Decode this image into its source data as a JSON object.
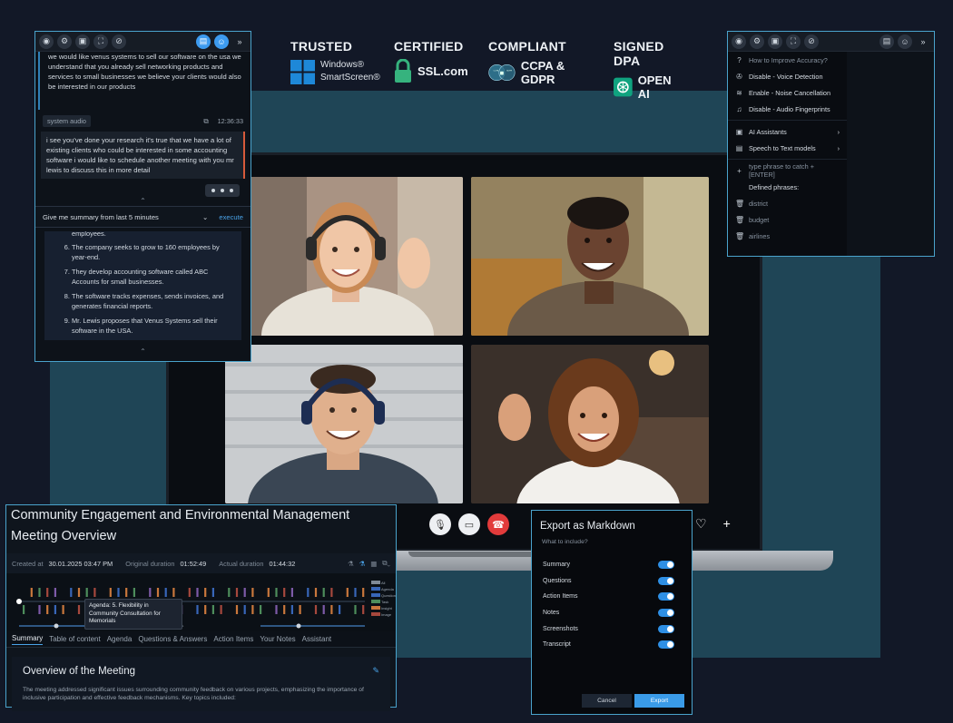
{
  "badges": {
    "trusted": {
      "title": "TRUSTED",
      "line1": "Windows®",
      "line2": "SmartScreen®"
    },
    "certified": {
      "title": "CERTIFIED",
      "name": "SSL.com"
    },
    "compliant": {
      "title": "COMPLIANT",
      "name": "CCPA & GDPR",
      "logo_left": "CCPA",
      "logo_right": "GDPR"
    },
    "dpa": {
      "title": "SIGNED DPA",
      "name": "OPEN AI"
    }
  },
  "left_panel": {
    "transcript_top": "we would like venus systems to sell our software on the usa we understand that you already sell networking products and services to small businesses we believe your clients would also be interested in our products",
    "system_audio_label": "system audio",
    "system_audio_time": "12:36:33",
    "system_audio_text": "i see you've done your research it's true that we have a lot of existing clients who could be interested in some accounting software i would like to schedule another meeting with you mr lewis to discuss this in more detail",
    "command": "Give me summary from last 5 minutes",
    "execute": "execute",
    "summary_partial": "employees.",
    "summary_items": [
      "The company seeks to grow to 160 employees by year-end.",
      "They develop accounting software called ABC Accounts for small businesses.",
      "The software tracks expenses, sends invoices, and generates financial reports.",
      "Mr. Lewis proposes that Venus Systems sell their software in the USA."
    ],
    "summary_start": 6
  },
  "right_panel": {
    "items": [
      {
        "icon": "help",
        "label": "How to Improve Accuracy?",
        "dim": true
      },
      {
        "icon": "mic",
        "label": "Disable - Voice Detection"
      },
      {
        "icon": "wave",
        "label": "Enable - Noise Cancellation"
      },
      {
        "icon": "bell",
        "label": "Disable - Audio Fingerprints"
      },
      {
        "icon": "bot",
        "label": "AI Assistants",
        "sub": "›"
      },
      {
        "icon": "doc",
        "label": "Speech to Text models",
        "sub": "›"
      },
      {
        "icon": "plus",
        "label": "type phrase to catch + [ENTER]",
        "dim": true
      },
      {
        "icon": "",
        "label": "Defined phrases:"
      },
      {
        "icon": "trash",
        "label": "district",
        "dim": true
      },
      {
        "icon": "trash",
        "label": "budget",
        "dim": true
      },
      {
        "icon": "trash",
        "label": "airlines",
        "dim": true
      }
    ]
  },
  "meeting": {
    "title_line1": "Community Engagement and Environmental Management",
    "title_line2": "Meeting Overview",
    "created_label": "Created at",
    "created_value": "30.01.2025 03:47 PM",
    "orig_label": "Original duration",
    "orig_value": "01:52:49",
    "actual_label": "Actual duration",
    "actual_value": "01:44:32",
    "tooltip": "Agenda: 5. Flexibility in Community Consultation for Memorials",
    "legend": [
      "All",
      "Agenda",
      "Question",
      "Task",
      "Insight",
      "Image"
    ],
    "tabs": [
      "Summary",
      "Table of content",
      "Agenda",
      "Questions & Answers",
      "Action Items",
      "Your Notes",
      "Assistant"
    ],
    "overview_title": "Overview of the Meeting",
    "overview_text": "The meeting addressed significant issues surrounding community feedback on various projects, emphasizing the importance of inclusive participation and effective feedback mechanisms. Key topics included:"
  },
  "export": {
    "title": "Export as Markdown",
    "question": "What to include?",
    "options": [
      {
        "label": "Summary",
        "on": true
      },
      {
        "label": "Questions",
        "on": true
      },
      {
        "label": "Action Items",
        "on": true
      },
      {
        "label": "Notes",
        "on": true
      },
      {
        "label": "Screenshots",
        "on": true
      },
      {
        "label": "Transcript",
        "on": true
      }
    ],
    "cancel": "Cancel",
    "export": "Export"
  },
  "colors": {
    "accent": "#3d9bef",
    "panel_border": "#4aa3cc",
    "teal": "#1f4556",
    "end_call": "#e23b3b"
  }
}
